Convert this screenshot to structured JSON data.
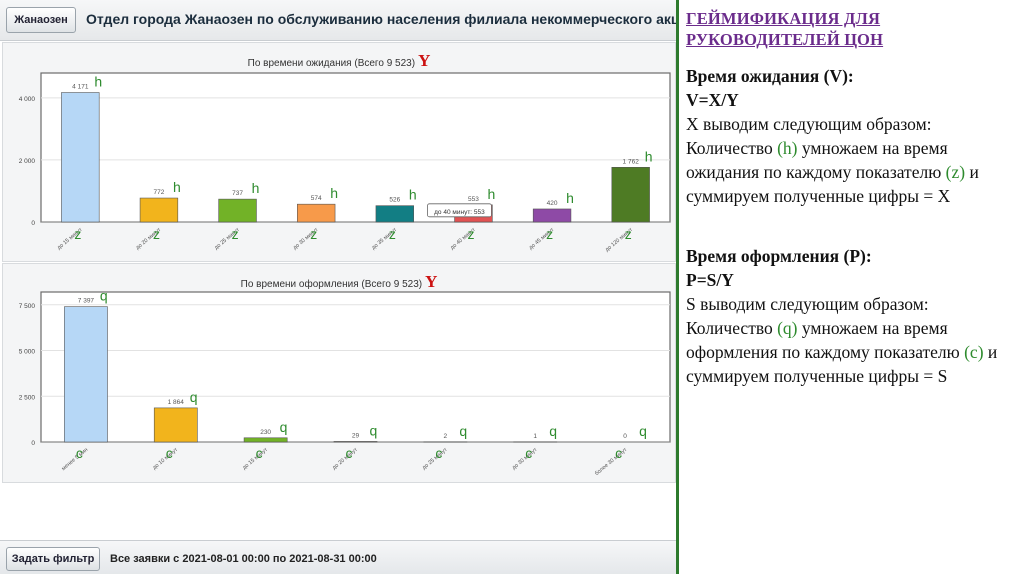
{
  "app": {
    "tab_label": "Жанаозен",
    "title": "Отдел города Жанаозен по обслуживанию населения филиала некоммерческого акционерног"
  },
  "chart_data": [
    {
      "type": "bar",
      "title": "По времени ожидания (Всего 9 523)",
      "y_marker": "Y",
      "yticks": [
        0,
        2000,
        4000
      ],
      "ytick_labels": [
        "0",
        "2 000",
        "4 000"
      ],
      "ylim": [
        0,
        4800
      ],
      "categories": [
        "до 15 минут",
        "до 20 минут",
        "до 25 минут",
        "до 30 минут",
        "до 35 минут",
        "до 40 минут",
        "до 45 минут",
        "до 120 минут"
      ],
      "values": [
        4171,
        772,
        737,
        574,
        526,
        553,
        420,
        1762
      ],
      "value_labels": [
        "4 171",
        "772",
        "737",
        "574",
        "526",
        "553",
        "420",
        "1 762"
      ],
      "colors": [
        "#b6d7f6",
        "#f2b41c",
        "#72b227",
        "#f79a4a",
        "#127e84",
        "#e15252",
        "#8e4aa6",
        "#4e7b24"
      ],
      "bar_annotations": "h",
      "axis_annotations": "z",
      "tooltip": "до 40 минут: 553",
      "grid": true
    },
    {
      "type": "bar",
      "title": "По времени оформления (Всего 9 523)",
      "y_marker": "Y",
      "yticks": [
        0,
        2500,
        5000,
        7500
      ],
      "ytick_labels": [
        "0",
        "2 500",
        "5 000",
        "7 500"
      ],
      "ylim": [
        0,
        8200
      ],
      "categories": [
        "менее 5 мин",
        "до 10 минут",
        "до 15 минут",
        "до 20 минут",
        "до 25 минут",
        "до 30 минут",
        "более 30 минут"
      ],
      "values": [
        7397,
        1864,
        230,
        29,
        2,
        1,
        0
      ],
      "value_labels": [
        "7 397",
        "1 864",
        "230",
        "29",
        "2",
        "1",
        "0"
      ],
      "colors": [
        "#b6d7f6",
        "#f2b41c",
        "#72b227",
        "#f79a4a",
        "#127e84",
        "#e15252",
        "#8e4aa6"
      ],
      "bar_annotations": "q",
      "axis_annotations": "c",
      "grid": true
    }
  ],
  "bottom": {
    "filter_label": "Задать фильтр",
    "period": "Все заявки с 2021-08-01 00:00 по 2021-08-31 00:00"
  },
  "notes": {
    "heading": "ГЕЙМИФИКАЦИЯ ДЛЯ РУКОВОДИТЕЛЕЙ ЦОН",
    "v_title": "Время ожидания (V):",
    "v_formula": "V=X/Y",
    "x_intro": "X выводим следующим образом:",
    "x_p1": "Количество ",
    "x_h": "(h)",
    "x_p2": " умножаем на время ожидания по каждому показателю ",
    "x_z": "(z)",
    "x_p3": " и суммируем полученные цифры = X",
    "p_title": "Время оформления (P):",
    "p_formula": "P=S/Y",
    "s_intro": "S выводим следующим образом:",
    "s_p1": "Количество ",
    "s_q": "(q)",
    "s_p2": " умножаем на время оформления по каждому показателю ",
    "s_c": "(с)",
    "s_p3": " и суммируем полученные цифры = S"
  },
  "colors": {
    "divider": "#2d7a2d",
    "heading": "#6b2c8c",
    "annotation": "#2e8b2e",
    "marker": "#cc1111"
  }
}
